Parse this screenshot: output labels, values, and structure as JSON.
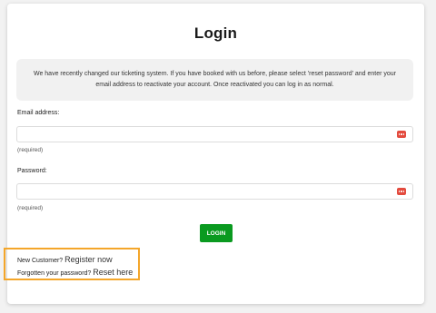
{
  "title": "Login",
  "notice": "We have recently changed our ticketing system. If you have booked with us before, please select 'reset password' and enter your email address to reactivate your account. Once reactivated you can log in as normal.",
  "email": {
    "label": "Email address:",
    "value": "",
    "hint": "(required)"
  },
  "password": {
    "label": "Password:",
    "value": "",
    "hint": "(required)"
  },
  "login_button": "LOGIN",
  "register": {
    "prompt": "New Customer?",
    "link": "Register now"
  },
  "reset": {
    "prompt": "Forgotten your password?",
    "link": "Reset here"
  },
  "colors": {
    "login_button": "#0a9a20",
    "highlight": "#f4a62a",
    "password_manager_icon": "#e34b3e"
  },
  "icons": [
    "password-manager-icon"
  ]
}
